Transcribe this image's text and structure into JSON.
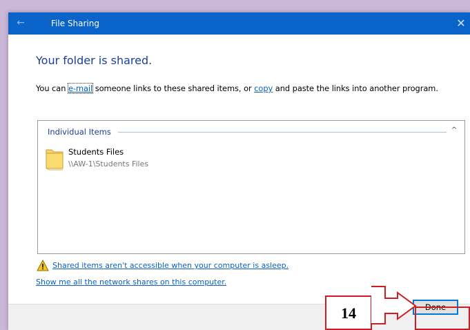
{
  "window": {
    "title": "File Sharing",
    "back_glyph": "←",
    "close_glyph": "✕"
  },
  "main": {
    "heading": "Your folder is shared.",
    "desc_part1": "You can ",
    "email_link": "e-mail",
    "desc_part2": " someone links to these shared items, or ",
    "copy_link": "copy",
    "desc_part3": " and paste the links into another program."
  },
  "items": {
    "group_label": "Individual Items",
    "caret": "^",
    "list": [
      {
        "name": "Students Files",
        "path": "\\\\AW-1\\Students Files",
        "icon": "folder-icon"
      }
    ]
  },
  "links": {
    "warning": "Shared items aren't accessible when your computer is asleep.",
    "warning_icon": "warning-icon",
    "network": "Show me all the network shares on this computer."
  },
  "footer": {
    "done_label": "Done"
  },
  "annotation": {
    "step_number": "14",
    "color": "#cc1d25"
  },
  "colors": {
    "titlebar": "#0a63c9",
    "heading": "#1c3f94",
    "link": "#0b5fbf"
  }
}
